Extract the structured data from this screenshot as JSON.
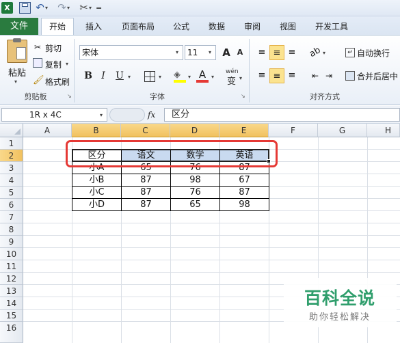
{
  "qat": {
    "dropdown_char": "="
  },
  "tabs": [
    "文件",
    "开始",
    "插入",
    "页面布局",
    "公式",
    "数据",
    "审阅",
    "视图",
    "开发工具"
  ],
  "clipboard": {
    "paste": "粘贴",
    "cut": "剪切",
    "copy": "复制",
    "format_painter": "格式刷",
    "group": "剪贴板"
  },
  "font": {
    "name": "宋体",
    "size": "11",
    "bold": "B",
    "italic": "I",
    "underline": "U",
    "grow": "A",
    "shrink": "A",
    "group": "字体",
    "phonetic": "wén"
  },
  "align": {
    "wrap": "自动换行",
    "merge": "合并后居中",
    "group": "对齐方式"
  },
  "formula_bar": {
    "name_box": "1R x 4C",
    "fx": "fx",
    "content": "区分"
  },
  "columns": [
    "A",
    "B",
    "C",
    "D",
    "E",
    "F",
    "G",
    "H"
  ],
  "rows": [
    "1",
    "2",
    "3",
    "4",
    "5",
    "6",
    "7",
    "8",
    "9",
    "10",
    "11",
    "12",
    "13",
    "14",
    "15",
    "16"
  ],
  "table": {
    "header": [
      "区分",
      "语文",
      "数学",
      "英语"
    ],
    "rows": [
      [
        "小A",
        "65",
        "76",
        "87"
      ],
      [
        "小B",
        "87",
        "98",
        "67"
      ],
      [
        "小C",
        "87",
        "76",
        "87"
      ],
      [
        "小D",
        "87",
        "65",
        "98"
      ]
    ]
  },
  "watermark": {
    "title": "百科全说",
    "subtitle": "助你轻松解决"
  },
  "colors": {
    "file_tab": "#2a7b3f",
    "highlight": "#e53935",
    "selected_header": "#c9daf0"
  }
}
